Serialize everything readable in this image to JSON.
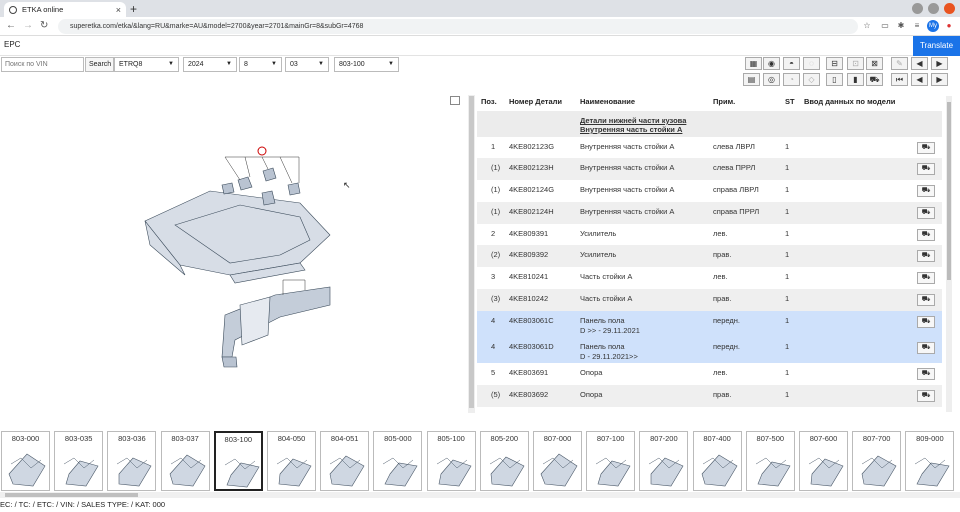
{
  "browser": {
    "tab_title": "ETKA online",
    "url": "superetka.com/etka/&lang=RU&marke=AU&model=2700&year=2701&mainGr=8&subGr=4768",
    "profile_initials": "My"
  },
  "app": {
    "epc_label": "EPC",
    "translate_label": "Translate"
  },
  "controls": {
    "vin_placeholder": "Поиск по VIN",
    "search_label": "Search",
    "catalog": "ETRQ8",
    "year": "2024",
    "main_group": "8",
    "sub_group": "03",
    "illustration": "803-100"
  },
  "table": {
    "headers": {
      "pos": "Поз.",
      "part": "Номер Детали",
      "name": "Наименование",
      "note": "Прим.",
      "st": "ST",
      "model": "Ввод данных по модели"
    },
    "group_title": [
      "Детали нижней части кузова",
      "Внутренняя часть стойки А"
    ],
    "rows": [
      {
        "pos": "1",
        "part": "4KE802123G",
        "name": "Внутренняя часть стойки А",
        "name2": "",
        "note": "слева ЛВРЛ",
        "st": "1"
      },
      {
        "pos": "(1)",
        "part": "4KE802123H",
        "name": "Внутренняя часть стойки А",
        "name2": "",
        "note": "слева ПРРЛ",
        "st": "1"
      },
      {
        "pos": "(1)",
        "part": "4KE802124G",
        "name": "Внутренняя часть стойки А",
        "name2": "",
        "note": "справа ЛВРЛ",
        "st": "1"
      },
      {
        "pos": "(1)",
        "part": "4KE802124H",
        "name": "Внутренняя часть стойки А",
        "name2": "",
        "note": "справа ПРРЛ",
        "st": "1"
      },
      {
        "pos": "2",
        "part": "4KE809391",
        "name": "Усилитель",
        "name2": "",
        "note": "лев.",
        "st": "1"
      },
      {
        "pos": "(2)",
        "part": "4KE809392",
        "name": "Усилитель",
        "name2": "",
        "note": "прав.",
        "st": "1"
      },
      {
        "pos": "3",
        "part": "4KE810241",
        "name": "Часть стойки А",
        "name2": "",
        "note": "лев.",
        "st": "1"
      },
      {
        "pos": "(3)",
        "part": "4KE810242",
        "name": "Часть стойки А",
        "name2": "",
        "note": "прав.",
        "st": "1"
      },
      {
        "pos": "4",
        "part": "4KE803061C",
        "name": "Панель пола",
        "name2": "D >> - 29.11.2021",
        "note": "передн.",
        "st": "1"
      },
      {
        "pos": "4",
        "part": "4KE803061D",
        "name": "Панель пола",
        "name2": "D - 29.11.2021>>",
        "note": "передн.",
        "st": "1"
      },
      {
        "pos": "5",
        "part": "4KE803691",
        "name": "Опора",
        "name2": "",
        "note": "лев.",
        "st": "1"
      },
      {
        "pos": "(5)",
        "part": "4KE803692",
        "name": "Опора",
        "name2": "",
        "note": "прав.",
        "st": "1"
      }
    ]
  },
  "thumbnails": [
    "803-000",
    "803-035",
    "803-036",
    "803-037",
    "803-100",
    "804-050",
    "804-051",
    "805-000",
    "805-100",
    "805-200",
    "807-000",
    "807-100",
    "807-200",
    "807-400",
    "807-500",
    "807-600",
    "807-700",
    "809-000"
  ],
  "status_bar": "EC: / TC: / ETC: / VIN: / SALES TYPE: / KAT: 000",
  "colors": {
    "highlight_row": "#cfe1fb",
    "accent": "#1a73e8"
  }
}
